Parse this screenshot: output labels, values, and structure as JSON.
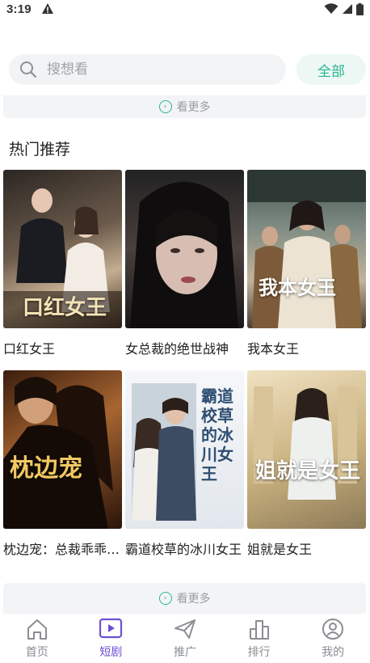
{
  "status_bar": {
    "time": "3:19"
  },
  "search": {
    "placeholder": "搜想看",
    "all_label": "全部"
  },
  "more_label": "看更多",
  "section": {
    "title": "热门推荐"
  },
  "dramas": [
    {
      "title": "口红女王",
      "cover_text": "口红女王",
      "colors": [
        "#3a2e2a",
        "#b9a58c",
        "#2a211c"
      ]
    },
    {
      "title": "女总裁的绝世战神",
      "cover_text": "",
      "colors": [
        "#1c1c1e",
        "#6a5f5c",
        "#d9c8c1"
      ]
    },
    {
      "title": "我本女王",
      "cover_text": "我本女王",
      "colors": [
        "#5a6e6a",
        "#c7b9a4",
        "#3b3430"
      ]
    },
    {
      "title": "枕边宠：总裁乖乖叫女王",
      "cover_text": "枕边宠",
      "colors": [
        "#5a2d16",
        "#c97d3c",
        "#2b1409"
      ]
    },
    {
      "title": "霸道校草的冰川女王",
      "cover_text": "霸道校草的冰川女王",
      "colors": [
        "#e8edf2",
        "#9fb3c8",
        "#f4f6f8"
      ]
    },
    {
      "title": "姐就是女王",
      "cover_text": "姐就是女王",
      "colors": [
        "#e4d4b0",
        "#b7a27a",
        "#f3ead6"
      ]
    }
  ],
  "tabs": [
    {
      "label": "首页",
      "icon": "home-icon",
      "active": false
    },
    {
      "label": "短剧",
      "icon": "play-icon",
      "active": true
    },
    {
      "label": "推广",
      "icon": "paper-plane-icon",
      "active": false
    },
    {
      "label": "排行",
      "icon": "bar-chart-icon",
      "active": false
    },
    {
      "label": "我的",
      "icon": "user-icon",
      "active": false
    }
  ],
  "colors": {
    "accent": "#2ab58e",
    "active_tab": "#6c4fd6"
  }
}
